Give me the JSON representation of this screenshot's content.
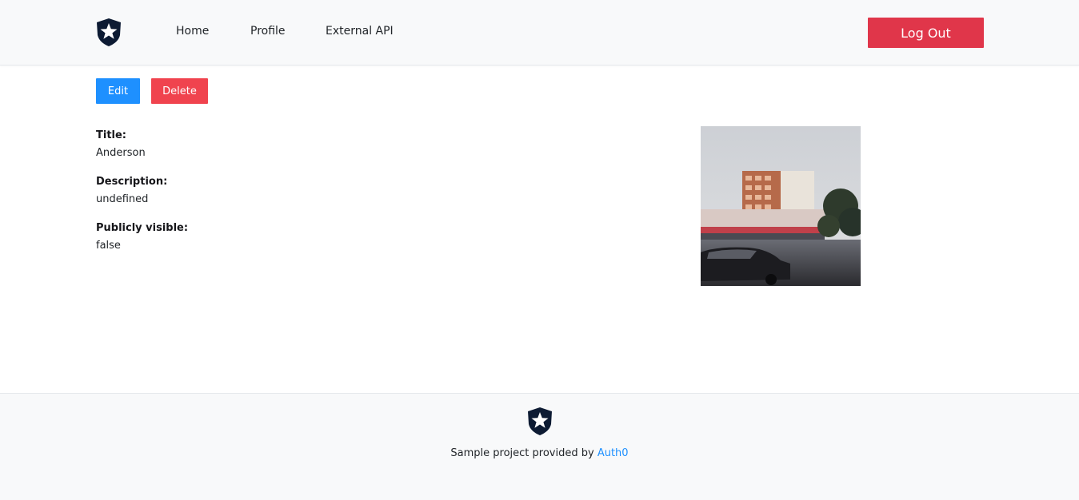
{
  "nav": {
    "logo_icon": "auth0-shield-star-icon",
    "links": [
      {
        "label": "Home"
      },
      {
        "label": "Profile"
      },
      {
        "label": "External API"
      }
    ],
    "logout_label": "Log Out"
  },
  "actions": {
    "edit_label": "Edit",
    "delete_label": "Delete"
  },
  "details": {
    "title_label": "Title:",
    "title_value": "Anderson",
    "description_label": "Description:",
    "description_value": "undefined",
    "visibility_label": "Publicly visible:",
    "visibility_value": "false"
  },
  "photo": {
    "content": "city street photo with tall building and parked car"
  },
  "footer": {
    "logo_icon": "auth0-shield-star-icon",
    "text": "Sample project provided by",
    "link_label": "Auth0"
  },
  "colors": {
    "logout": "#e0364a",
    "edit": "#1e90ff",
    "delete": "#f0434e",
    "link": "#1e90ff",
    "nav_background": "#f8f9fa",
    "logo": "#0d1b33"
  }
}
